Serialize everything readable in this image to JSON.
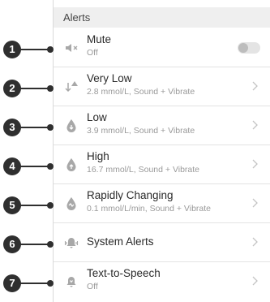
{
  "section": {
    "title": "Alerts"
  },
  "rows": [
    {
      "callout": "1",
      "icon": "speaker-muted-icon",
      "title": "Mute",
      "subtitle": "Off",
      "control": "toggle",
      "toggle_on": false
    },
    {
      "callout": "2",
      "icon": "very-low-alert-icon",
      "title": "Very Low",
      "subtitle": "2.8 mmol/L, Sound + Vibrate",
      "control": "chevron"
    },
    {
      "callout": "3",
      "icon": "low-drop-icon",
      "title": "Low",
      "subtitle": "3.9 mmol/L, Sound + Vibrate",
      "control": "chevron"
    },
    {
      "callout": "4",
      "icon": "high-drop-icon",
      "title": "High",
      "subtitle": "16.7 mmol/L, Sound + Vibrate",
      "control": "chevron"
    },
    {
      "callout": "5",
      "icon": "rapidly-changing-icon",
      "title": "Rapidly Changing",
      "subtitle": "0.1 mmol/L/min, Sound + Vibrate",
      "control": "chevron"
    },
    {
      "callout": "6",
      "icon": "bell-ringing-icon",
      "title": "System Alerts",
      "subtitle": "",
      "control": "chevron"
    },
    {
      "callout": "7",
      "icon": "bell-speech-icon",
      "title": "Text-to-Speech",
      "subtitle": "Off",
      "control": "chevron"
    }
  ],
  "colors": {
    "text": "#2a2a2a",
    "subtext": "#9a9a9a",
    "icon": "#a8a8a8",
    "header_bg": "#efefef",
    "callout": "#2f2f2f"
  }
}
